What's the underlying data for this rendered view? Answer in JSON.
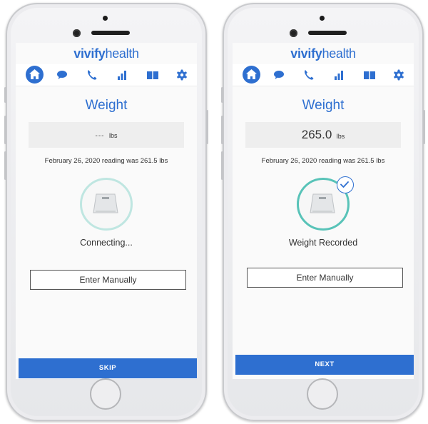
{
  "brand": {
    "logo_part1": "vivify",
    "logo_part2": "health",
    "color": "#2e6fd0"
  },
  "nav_icons": [
    "home-icon",
    "chat-icon",
    "phone-icon",
    "bar-chart-icon",
    "book-icon",
    "gear-icon"
  ],
  "colors": {
    "accent": "#2e6fd0",
    "scale_ring": "#58c3b8",
    "weight_box_bg": "#eeeeee"
  },
  "left_screen": {
    "title": "Weight",
    "weight_placeholder": "---",
    "weight_unit": "lbs",
    "previous_reading": "February 26, 2020 reading was 261.5 lbs",
    "status": "Connecting...",
    "manual_button": "Enter Manually",
    "primary_button": "SKIP"
  },
  "right_screen": {
    "title": "Weight",
    "weight_value": "265.0",
    "weight_unit": "lbs",
    "previous_reading": "February 26, 2020 reading was 261.5 lbs",
    "status": "Weight Recorded",
    "manual_button": "Enter Manually",
    "primary_button": "NEXT"
  }
}
